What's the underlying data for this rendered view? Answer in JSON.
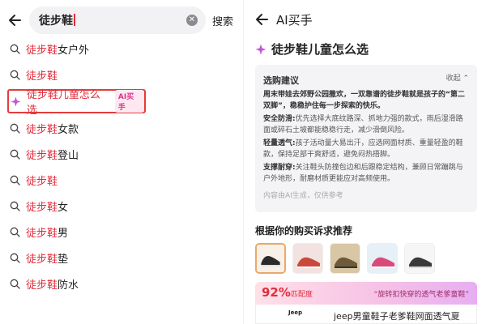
{
  "search": {
    "query": "徒步鞋",
    "clear_icon": "clear-circle-icon",
    "search_button": "搜索"
  },
  "suggestions": [
    {
      "highlight": "徒步鞋",
      "rest": "女户外",
      "type": "search"
    },
    {
      "highlight": "徒步鞋",
      "rest": "",
      "type": "search"
    },
    {
      "highlight": "徒步鞋儿童怎么选",
      "rest": "",
      "type": "ai",
      "badge": "AI买手"
    },
    {
      "highlight": "徒步鞋",
      "rest": "女款",
      "type": "search"
    },
    {
      "highlight": "徒步鞋",
      "rest": "登山",
      "type": "search"
    },
    {
      "highlight": "徒步鞋",
      "rest": "",
      "type": "search"
    },
    {
      "highlight": "徒步鞋",
      "rest": "女",
      "type": "search"
    },
    {
      "highlight": "徒步鞋",
      "rest": "男",
      "type": "search"
    },
    {
      "highlight": "徒步鞋",
      "rest": "垫",
      "type": "search"
    },
    {
      "highlight": "徒步鞋",
      "rest": "防水",
      "type": "search"
    }
  ],
  "ai_panel": {
    "title": "AI买手",
    "question": "徒步鞋儿童怎么选",
    "advice_title": "选购建议",
    "collapse_label": "收起",
    "lead": "周末带娃去郊野公园撒欢，一双靠谱的徒步鞋就是孩子的“第二双脚”，稳稳护住每一步探索的快乐。",
    "points": [
      {
        "label": "安全防滑:",
        "text": "优先选择大底纹路深、抓地力强的款式，雨后湿滑路面或碎石土坡都能稳稳行走，减少滑倒风险。"
      },
      {
        "label": "轻量透气:",
        "text": "孩子活动量大易出汗，应选网面材质、重量轻盈的鞋款，保持足部干爽舒适，避免闷热捂脚。"
      },
      {
        "label": "支撑耐穿:",
        "text": "关注鞋头防撞包边和后跟稳定结构，兼顾日常蹦跳与户外地形，耐磨材质更能应对高频使用。"
      }
    ],
    "footer": "内容由AI生成，仅供参考",
    "recommend_title": "根据你的购买诉求推荐",
    "match_percent": "92%",
    "match_label": "匹配度",
    "match_tag": "“旋转扣快穿的透气老爹童鞋”",
    "brand": "Jeep",
    "product_name": "jeep男童鞋子老爹鞋网面透气夏"
  },
  "colors": {
    "highlight": "#e02d3c",
    "ai_badge_bg": "#fde8f1",
    "ai_badge_text": "#d9368c",
    "card_bg": "#f4f4f6"
  }
}
